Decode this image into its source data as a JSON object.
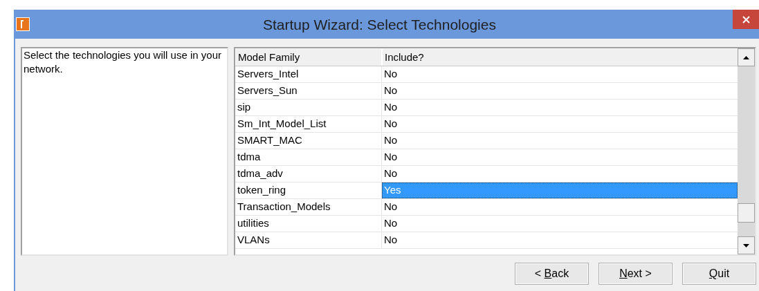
{
  "window": {
    "title": "Startup Wizard: Select Technologies"
  },
  "instructions": "Select the technologies you will use in your network.",
  "table": {
    "columns": [
      "Model Family",
      "Include?"
    ],
    "rows": [
      {
        "model_family": "Servers_Intel",
        "include": "No",
        "selected": false
      },
      {
        "model_family": "Servers_Sun",
        "include": "No",
        "selected": false
      },
      {
        "model_family": "sip",
        "include": "No",
        "selected": false
      },
      {
        "model_family": "Sm_Int_Model_List",
        "include": "No",
        "selected": false
      },
      {
        "model_family": "SMART_MAC",
        "include": "No",
        "selected": false
      },
      {
        "model_family": "tdma",
        "include": "No",
        "selected": false
      },
      {
        "model_family": "tdma_adv",
        "include": "No",
        "selected": false
      },
      {
        "model_family": "token_ring",
        "include": "Yes",
        "selected": true
      },
      {
        "model_family": "Transaction_Models",
        "include": "No",
        "selected": false
      },
      {
        "model_family": "utilities",
        "include": "No",
        "selected": false
      },
      {
        "model_family": "VLANs",
        "include": "No",
        "selected": false
      }
    ]
  },
  "buttons": [
    {
      "prefix": "< ",
      "mnemonic": "B",
      "suffix": "ack"
    },
    {
      "mnemonic": "N",
      "suffix": "ext >"
    },
    {
      "mnemonic": "Q",
      "suffix": "uit"
    }
  ]
}
